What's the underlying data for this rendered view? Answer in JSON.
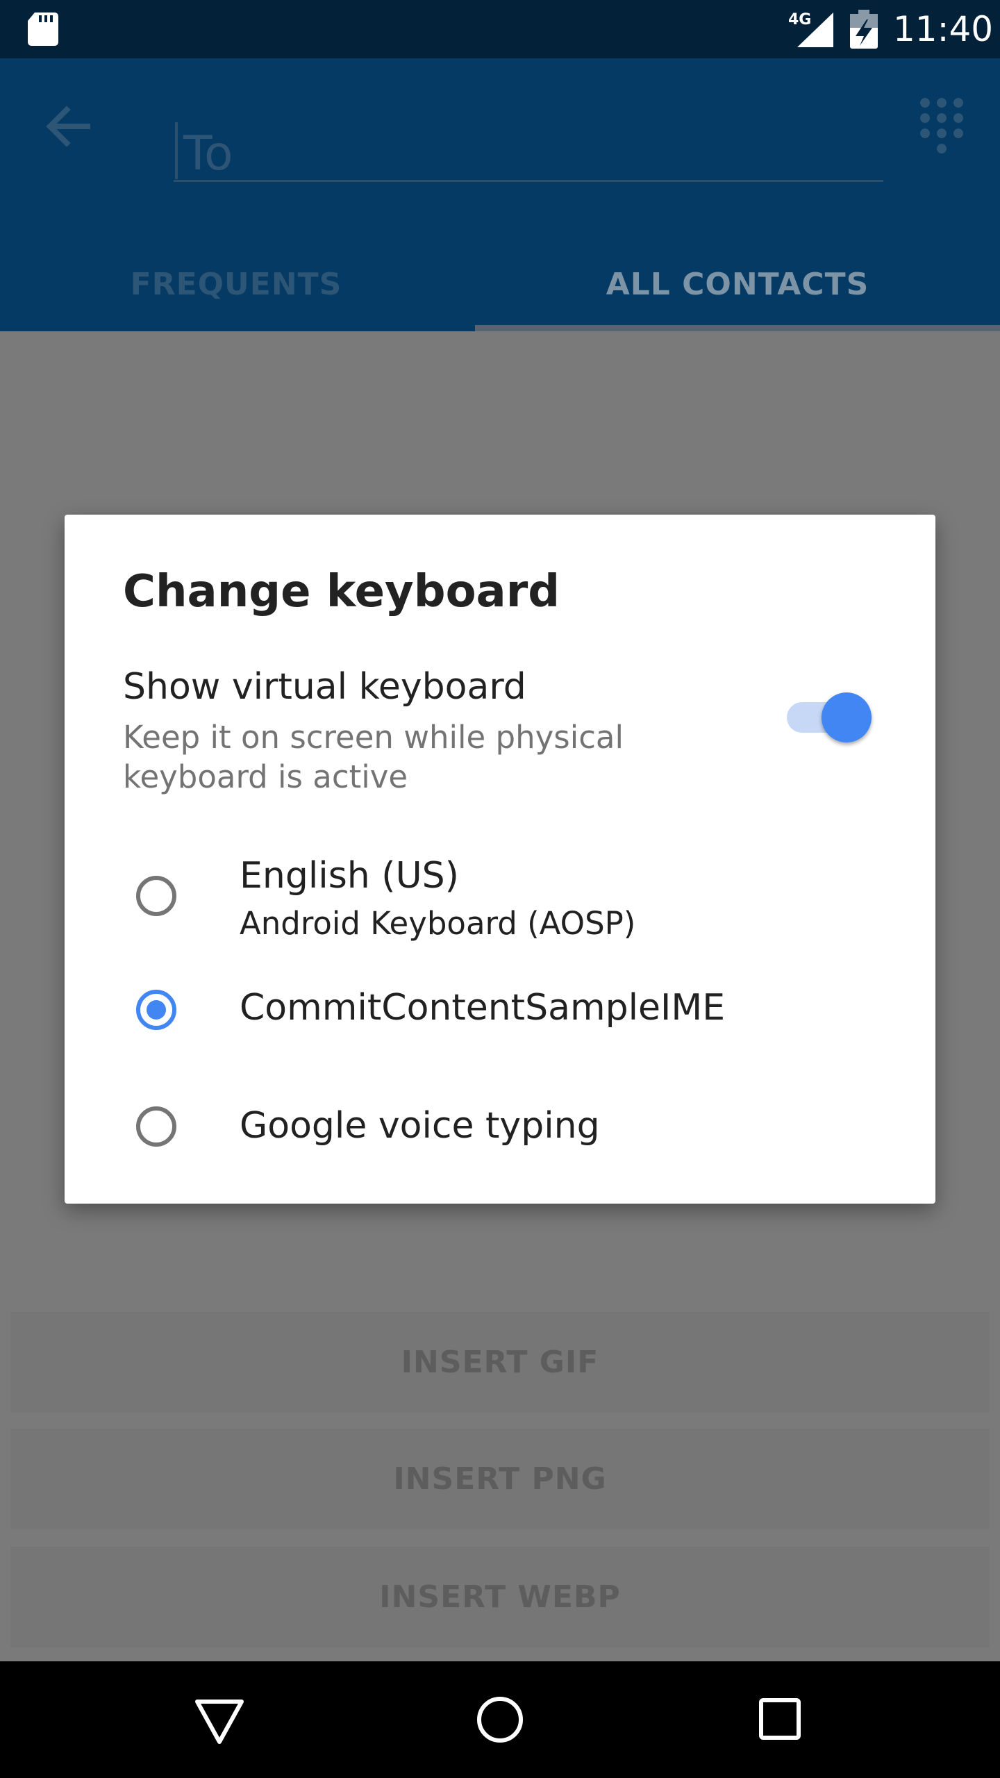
{
  "status_bar": {
    "network": "4G",
    "time": "11:40",
    "icons": [
      "sd-card-icon",
      "signal-icon",
      "battery-charging-icon"
    ]
  },
  "app_bar": {
    "to_placeholder": "To",
    "icons": [
      "back-arrow-icon",
      "dialpad-icon"
    ],
    "tabs": [
      {
        "label": "FREQUENTS",
        "selected": false
      },
      {
        "label": "ALL CONTACTS",
        "selected": true
      }
    ]
  },
  "content": {
    "buttons": [
      {
        "label": "INSERT GIF"
      },
      {
        "label": "INSERT PNG"
      },
      {
        "label": "INSERT WEBP"
      }
    ]
  },
  "dialog": {
    "title": "Change keyboard",
    "show_virtual": {
      "title": "Show virtual keyboard",
      "subtitle": "Keep it on screen while physical keyboard is active",
      "enabled": true
    },
    "options": [
      {
        "label": "English (US)",
        "sublabel": "Android Keyboard (AOSP)",
        "selected": false
      },
      {
        "label": "CommitContentSampleIME",
        "selected": true
      },
      {
        "label": "Google voice typing",
        "selected": false
      }
    ]
  },
  "nav_bar": {
    "icons": [
      "nav-back-icon",
      "nav-home-icon",
      "nav-recents-icon"
    ]
  },
  "colors": {
    "app_bar": "#043a63",
    "status_bar": "#04213a",
    "accent": "#4286f4",
    "scrim": "#7a7a7a"
  }
}
